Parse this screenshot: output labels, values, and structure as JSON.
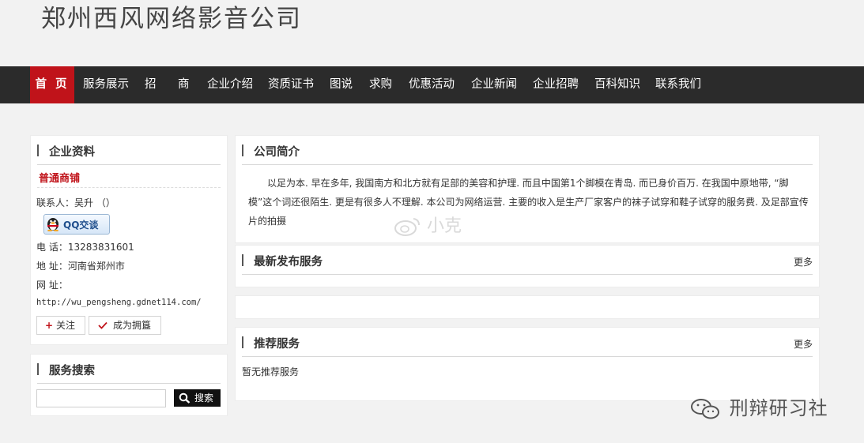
{
  "header": {
    "title": "郑州西风网络影音公司"
  },
  "nav": {
    "items": [
      {
        "label": "首 页",
        "active": true
      },
      {
        "label": "服务展示"
      },
      {
        "label": "招"
      },
      {
        "label": "商"
      },
      {
        "label": "企业介绍"
      },
      {
        "label": "资质证书"
      },
      {
        "label": "图说"
      },
      {
        "label": "求购"
      },
      {
        "label": "优惠活动"
      },
      {
        "label": "企业新闻"
      },
      {
        "label": "企业招聘"
      },
      {
        "label": "百科知识"
      },
      {
        "label": "联系我们"
      }
    ]
  },
  "company_info": {
    "title": "企业资料",
    "level": "普通商铺",
    "contact": "联系人：吴升 （）",
    "qq_label": "QQ交谈",
    "phone": "电 话：13283831601",
    "address": "地 址：河南省郑州市",
    "website_label": "网 址：",
    "website_url": "http://wu_pengsheng.gdnet114.com/",
    "follow_label": "关注",
    "owner_label": "成为拥簋"
  },
  "service_search": {
    "title": "服务搜索",
    "input_value": "",
    "button_label": "搜索"
  },
  "company_intro": {
    "title": "公司简介",
    "text": "以足为本. 早在多年, 我国南方和北方就有足部的美容和护理. 而且中国第1个脚模在青岛. 而已身价百万. 在我国中原地带, “脚模”这个词还很陌生. 更是有很多人不理解. 本公司为网络运营. 主要的收入是生产厂家客户的袜子试穿和鞋子试穿的服务费. 及足部宣传片的拍摄"
  },
  "latest_services": {
    "title": "最新发布服务",
    "more": "更多"
  },
  "recommended": {
    "title": "推荐服务",
    "more": "更多",
    "empty_text": "暂无推荐服务"
  },
  "watermarks": {
    "center": "小克",
    "bottom_right": "刑辩研习社"
  },
  "colors": {
    "nav_bg": "#2b2b2b",
    "accent": "#c0131a",
    "page_bg": "#f2f2f2"
  }
}
